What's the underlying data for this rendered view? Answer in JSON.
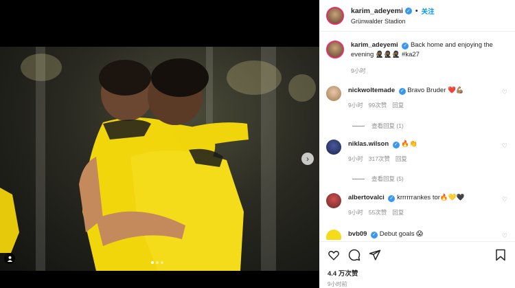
{
  "post": {
    "author": "karim_adeyemi",
    "follow_label": "关注",
    "separator": "•",
    "location": "Grünwalder Stadion",
    "caption_text": "Back home and enjoying the evening 🥷🏾🥷🏾🥷🏾 #ka27",
    "caption_time": "9小时"
  },
  "comments": [
    {
      "user": "nickwoltemade",
      "text": "Bravo Bruder ❤️💪🏽",
      "time": "9小时",
      "likes": "99次赞",
      "reply": "回复",
      "view_replies": "查看回复 (1)"
    },
    {
      "user": "niklas.wilson",
      "text": "🔥👏",
      "time": "9小时",
      "likes": "317次赞",
      "reply": "回复",
      "view_replies": "查看回复 (5)"
    },
    {
      "user": "albertovalci",
      "text": "krrrrrrankes tor🔥💛🖤",
      "time": "9小时",
      "likes": "55次赞",
      "reply": "回复",
      "view_replies": ""
    },
    {
      "user": "bvb09",
      "text": "Debut goals 😱",
      "time": "",
      "likes": "",
      "reply": "",
      "view_replies": ""
    }
  ],
  "footer": {
    "likes": "4.4 万次赞",
    "time": "9小时前"
  },
  "icons": [
    "heart-icon",
    "comment-icon",
    "share-icon",
    "save-icon",
    "chevron-right-icon",
    "tag-icon"
  ],
  "colors": {
    "accent": "#0095f6",
    "verified": "#3897f0",
    "jersey": "#f5d90a"
  }
}
